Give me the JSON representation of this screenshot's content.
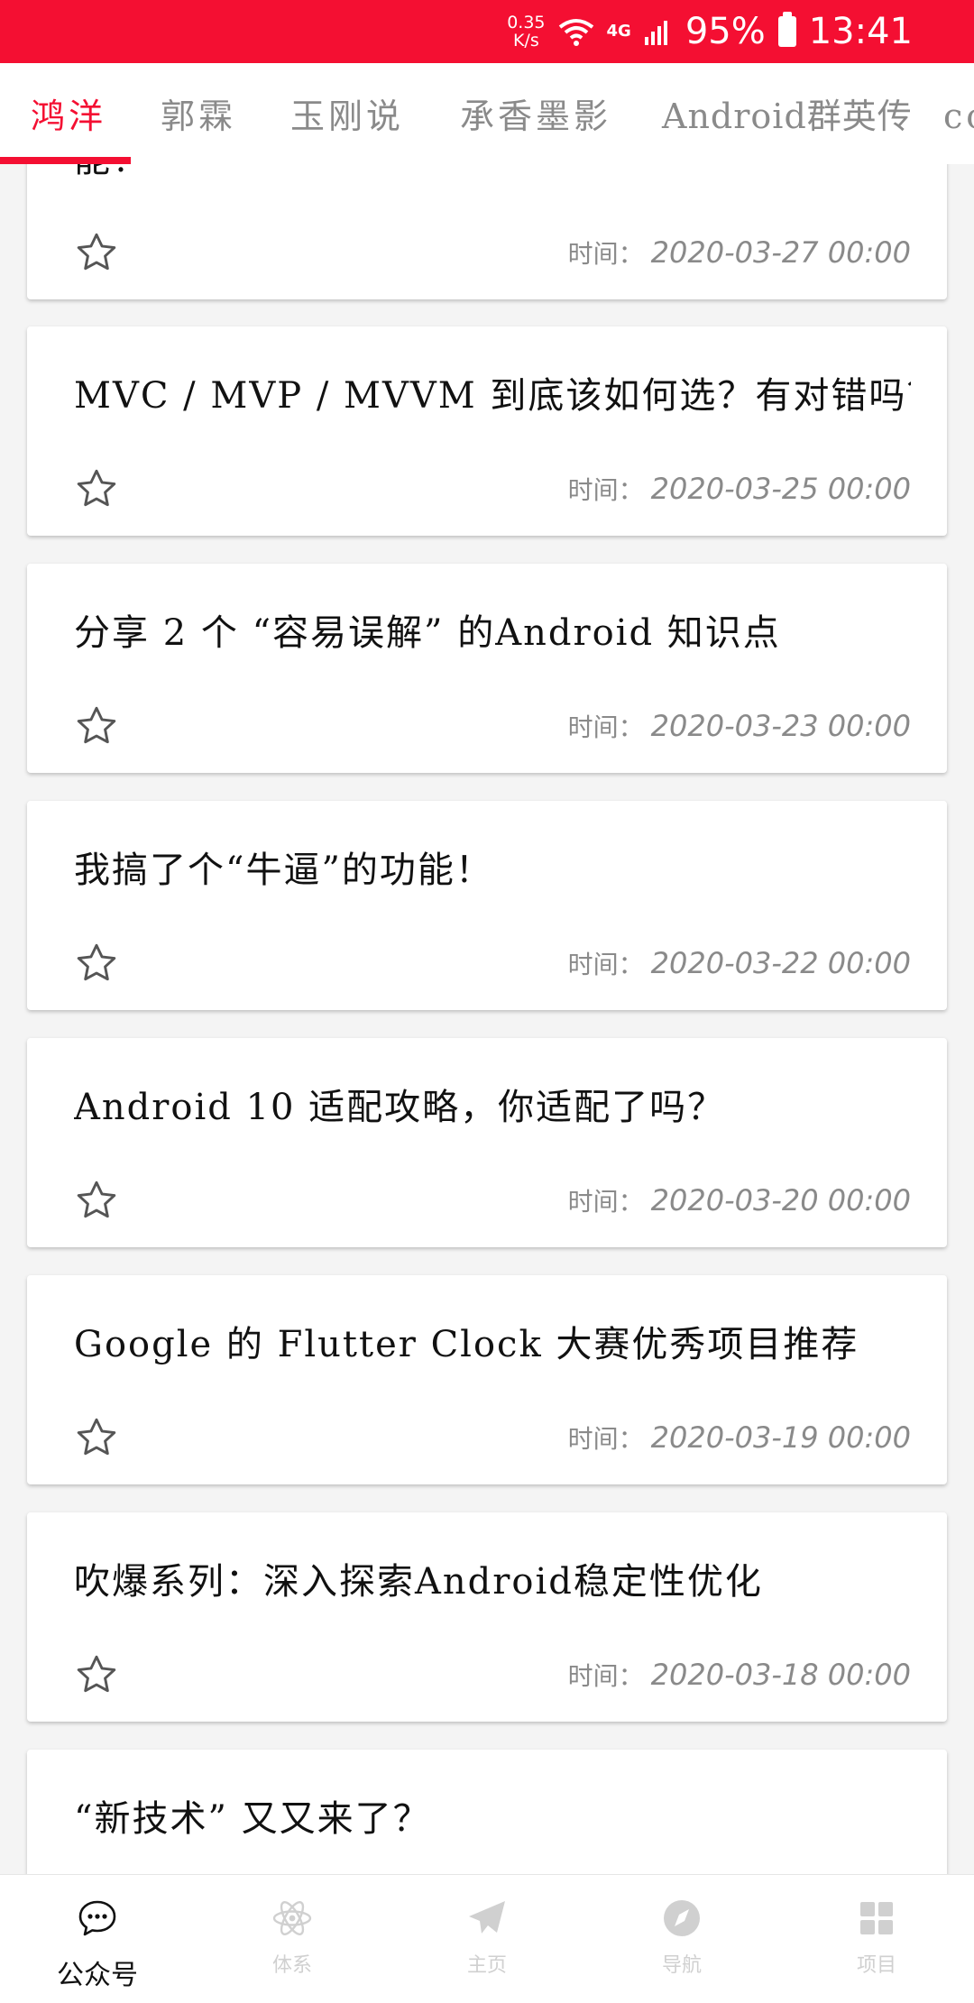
{
  "status_bar": {
    "speed_value": "0.35",
    "speed_unit": "K/s",
    "network": "4G",
    "battery": "95%",
    "time": "13:41"
  },
  "tabs": [
    {
      "label": "鸿洋",
      "active": true
    },
    {
      "label": "郭霖",
      "active": false
    },
    {
      "label": "玉刚说",
      "active": false
    },
    {
      "label": "承香墨影",
      "active": false
    },
    {
      "label": "Android群英传",
      "active": false
    },
    {
      "label": "co",
      "active": false
    }
  ],
  "list": {
    "time_label": "时间：",
    "articles": [
      {
        "title": "能！",
        "time": "2020-03-27 00:00"
      },
      {
        "title": "MVC / MVP / MVVM 到底该如何选？有对错吗？",
        "time": "2020-03-25 00:00"
      },
      {
        "title": "分享 2 个 “容易误解” 的Android 知识点",
        "time": "2020-03-23 00:00"
      },
      {
        "title": "我搞了个“牛逼”的功能！",
        "time": "2020-03-22 00:00"
      },
      {
        "title": "Android 10 适配攻略，你适配了吗？",
        "time": "2020-03-20 00:00"
      },
      {
        "title": "Google 的 Flutter Clock 大赛优秀项目推荐",
        "time": "2020-03-19 00:00"
      },
      {
        "title": "吹爆系列：深入探索Android稳定性优化",
        "time": "2020-03-18 00:00"
      },
      {
        "title": "“新技术” 又又来了？",
        "time": ""
      }
    ]
  },
  "bottom_nav": [
    {
      "label": "公众号",
      "icon": "chat-bubble-icon",
      "active": true
    },
    {
      "label": "体系",
      "icon": "atom-icon",
      "active": false
    },
    {
      "label": "主页",
      "icon": "paper-plane-icon",
      "active": false
    },
    {
      "label": "导航",
      "icon": "compass-icon",
      "active": false
    },
    {
      "label": "项目",
      "icon": "grid-icon",
      "active": false
    }
  ],
  "colors": {
    "accent": "#f40f32",
    "inactive_tab": "#8a8a8a",
    "inactive_nav": "#d0d0d0"
  }
}
